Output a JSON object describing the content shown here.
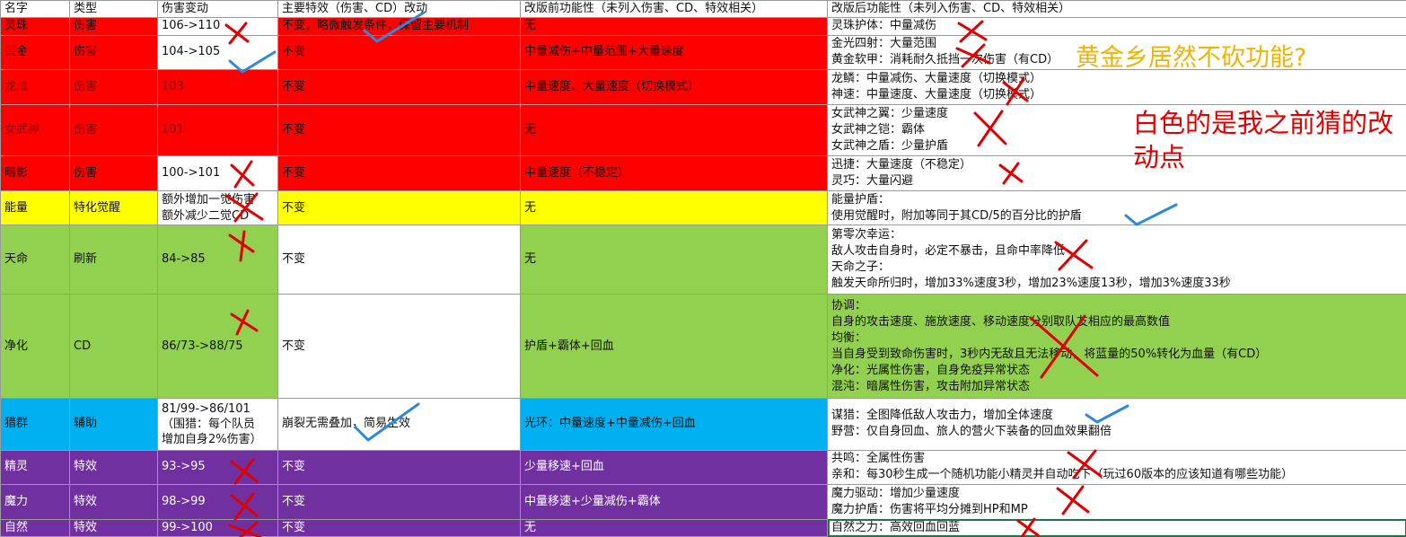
{
  "header": [
    "名字",
    "类型",
    "伤害变动",
    "主要特效（伤害、CD）改动",
    "改版前功能性（未列入伤害、CD、特效相关）",
    "改版后功能性（未列入伤害、CD、特效相关）"
  ],
  "rows": [
    {
      "name": "灵珠",
      "type": "伤害",
      "damage": [
        "106->110"
      ],
      "effect": "不变，略微触发条件，保留主要机制",
      "before": "无",
      "after": [
        "灵珠护体：中量减伤"
      ]
    },
    {
      "name": "黄金",
      "type": "伤害",
      "damage": [
        "104->105"
      ],
      "effect": "不变",
      "before": "中量减伤+中量范围+大量速度",
      "after": [
        "金光四射：大量范围",
        "黄金软甲：消耗耐久抵挡一次伤害（有CD）"
      ]
    },
    {
      "name": "龙战",
      "type": "伤害",
      "damage": [
        "103"
      ],
      "effect": "不变",
      "before": "中量速度、大量速度（切换模式）",
      "after": [
        "龙鳞：中量减伤、大量速度（切换模式）",
        "神速：中量速度、大量速度（切换模式）"
      ]
    },
    {
      "name": "女武神",
      "type": "伤害",
      "damage": [
        "101"
      ],
      "effect": "不变",
      "before": "无",
      "after": [
        "女武神之翼：少量速度",
        "女武神之铠：霸体",
        "女武神之盾：少量护盾"
      ]
    },
    {
      "name": "暗影",
      "type": "伤害",
      "damage": [
        "100->101"
      ],
      "effect": "不变",
      "before": "中量速度（不稳定）",
      "after": [
        "迅捷：大量速度（不稳定）",
        "灵巧：大量闪避"
      ]
    },
    {
      "name": "能量",
      "type": "特化觉醒",
      "damage": [
        "额外增加一觉伤害",
        "额外减少二觉CD"
      ],
      "effect": "不变",
      "before": "无",
      "after": [
        "能量护盾：",
        "使用觉醒时，附加等同于其CD/5的百分比的护盾"
      ]
    },
    {
      "name": "天命",
      "type": "刷新",
      "damage": [
        "84->85"
      ],
      "effect": "不变",
      "before": "无",
      "after": [
        "第零次幸运：",
        "敌人攻击自身时，必定不暴击，且命中率降低",
        "天命之子：",
        "触发天命所归时，增加33%速度3秒，增加23%速度13秒，增加3%速度33秒"
      ]
    },
    {
      "name": "净化",
      "type": "CD",
      "damage": [
        "86/73->88/75"
      ],
      "effect": "不变",
      "before": "护盾+霸体+回血",
      "after": [
        "协调：",
        "自身的攻击速度、施放速度、移动速度分别取队友相应的最高数值",
        "均衡：",
        "当自身受到致命伤害时，3秒内无敌且无法移动，将蓝量的50%转化为血量（有CD）",
        "净化：光属性伤害，自身免疫异常状态",
        "混沌：暗属性伤害，攻击附加异常状态"
      ]
    },
    {
      "name": "猎群",
      "type": "辅助",
      "damage": [
        "81/99->86/101",
        "（围猎：每个队员",
        "增加自身2%伤害）"
      ],
      "effect": "崩裂无需叠加，简易生效",
      "before": "光环：中量速度+中量减伤+回血",
      "after": [
        "谋猎：全图降低敌人攻击力，增加全体速度",
        "野营：仅自身回血、旅人的营火下装备的回血效果翻倍"
      ]
    },
    {
      "name": "精灵",
      "type": "特效",
      "damage": [
        "93->95"
      ],
      "effect": "不变",
      "before": "少量移速+回血",
      "after": [
        "共鸣：全属性伤害",
        "亲和：每30秒生成一个随机功能小精灵并自动吃下（玩过60版本的应该知道有哪些功能）"
      ]
    },
    {
      "name": "魔力",
      "type": "特效",
      "damage": [
        "98->99"
      ],
      "effect": "不变",
      "before": "中量移速+少量减伤+霸体",
      "after": [
        "魔力驱动：增加少量速度",
        "魔力护盾：伤害将平均分摊到HP和MP"
      ]
    },
    {
      "name": "自然",
      "type": "特效",
      "damage": [
        "99->100"
      ],
      "effect": "不变",
      "before": "无",
      "after": [
        "自然之力：高效回血回蓝"
      ]
    }
  ],
  "annotations": {
    "gold_note": "黄金乡居然不砍功能?",
    "white_note": "白色的是我之前猜的改动点"
  },
  "colors": {
    "red": "#ff0000",
    "yellow": "#ffff00",
    "green": "#92d050",
    "blue": "#00b0f0",
    "purple": "#7030a0",
    "mark_red": "#e00000",
    "mark_blue": "#2b8ae0",
    "note_gold": "#f0b400"
  }
}
